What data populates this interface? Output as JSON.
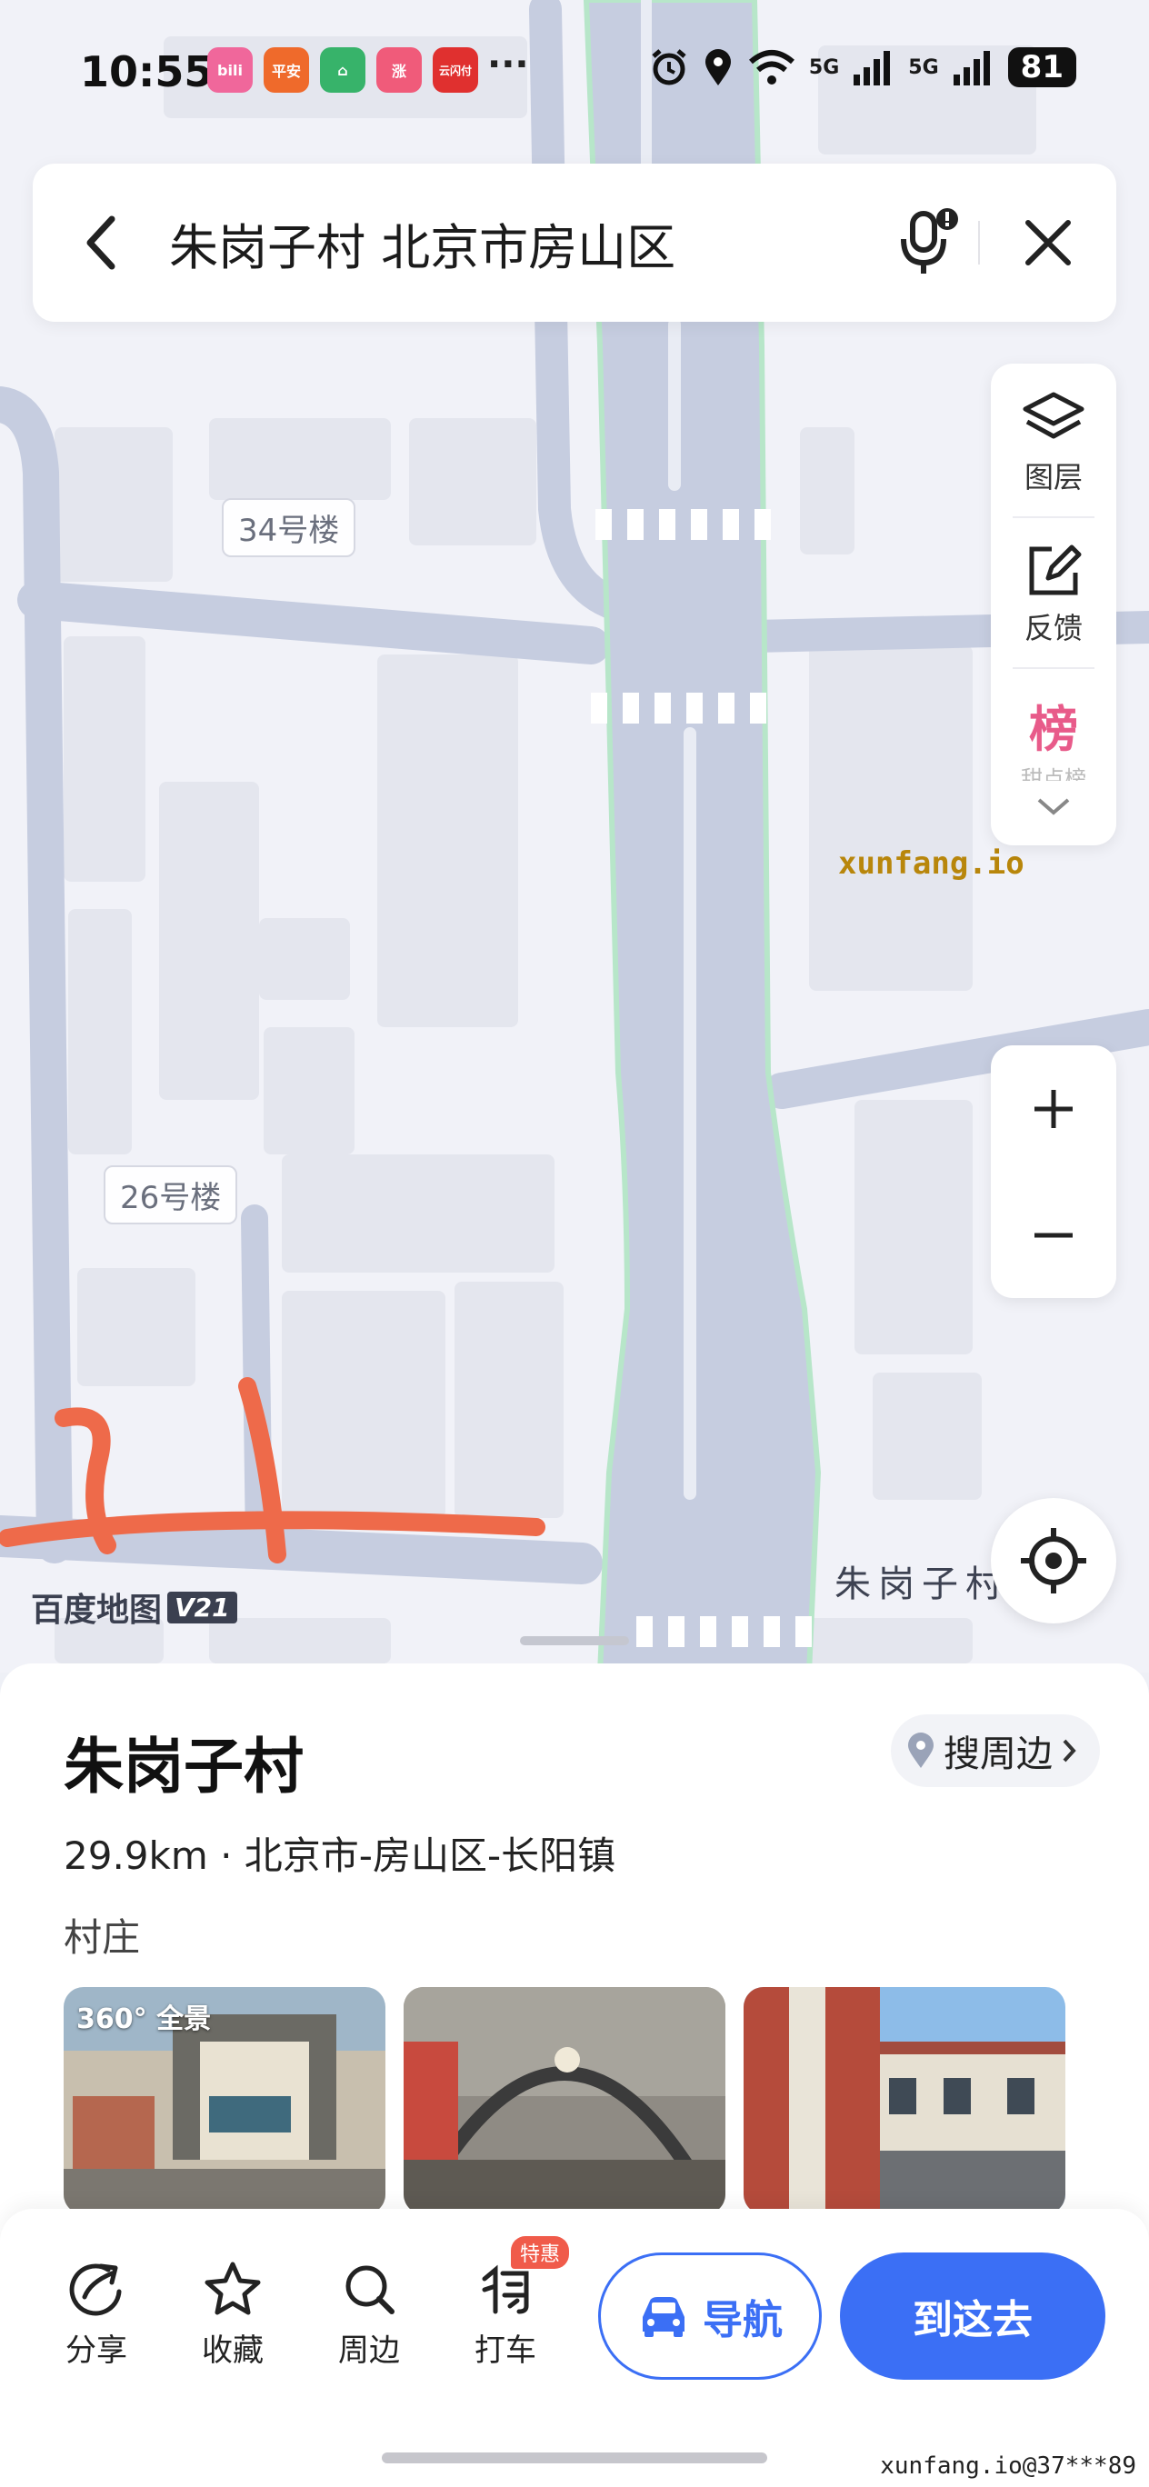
{
  "status_bar": {
    "time": "10:55",
    "apps": [
      {
        "name": "bilibili",
        "label": "bili",
        "color": "#f0679b"
      },
      {
        "name": "pingan-securities",
        "label": "平安",
        "color": "#ef6a2b"
      },
      {
        "name": "home-app",
        "label": "⌂",
        "color": "#37b36a"
      },
      {
        "name": "zhang-app",
        "label": "涨",
        "color": "#f05b7a"
      },
      {
        "name": "cloud-pay",
        "label": "云闪付",
        "color": "#e0302f"
      }
    ],
    "more": "···",
    "battery": "81",
    "signal_1": "5G",
    "signal_2": "5G"
  },
  "search": {
    "query": "朱岗子村 北京市房山区"
  },
  "map": {
    "building_labels": [
      "34号楼",
      "26号楼"
    ],
    "road_label": "朱岗子村",
    "watermark": "xunfang.io",
    "logo": "百度地图",
    "logo_version": "V21"
  },
  "tools": {
    "layers": "图层",
    "feedback": "反馈",
    "ranking": "榜",
    "ranking_label": "甜点榜"
  },
  "place": {
    "title": "朱岗子村",
    "nearby_label": "搜周边",
    "distance_address": "29.9km · 北京市-房山区-长阳镇",
    "type": "村庄",
    "pano_label": "360° 全景"
  },
  "actions": {
    "share": "分享",
    "favorite": "收藏",
    "nearby": "周边",
    "taxi": "打车",
    "taxi_badge": "特惠",
    "navigate": "导航",
    "go_here": "到这去"
  },
  "footer_watermark": "xunfang.io@37***89",
  "colors": {
    "accent": "#3b6ff5",
    "road": "#c6cde0",
    "annotation": "#ee6a4a"
  }
}
